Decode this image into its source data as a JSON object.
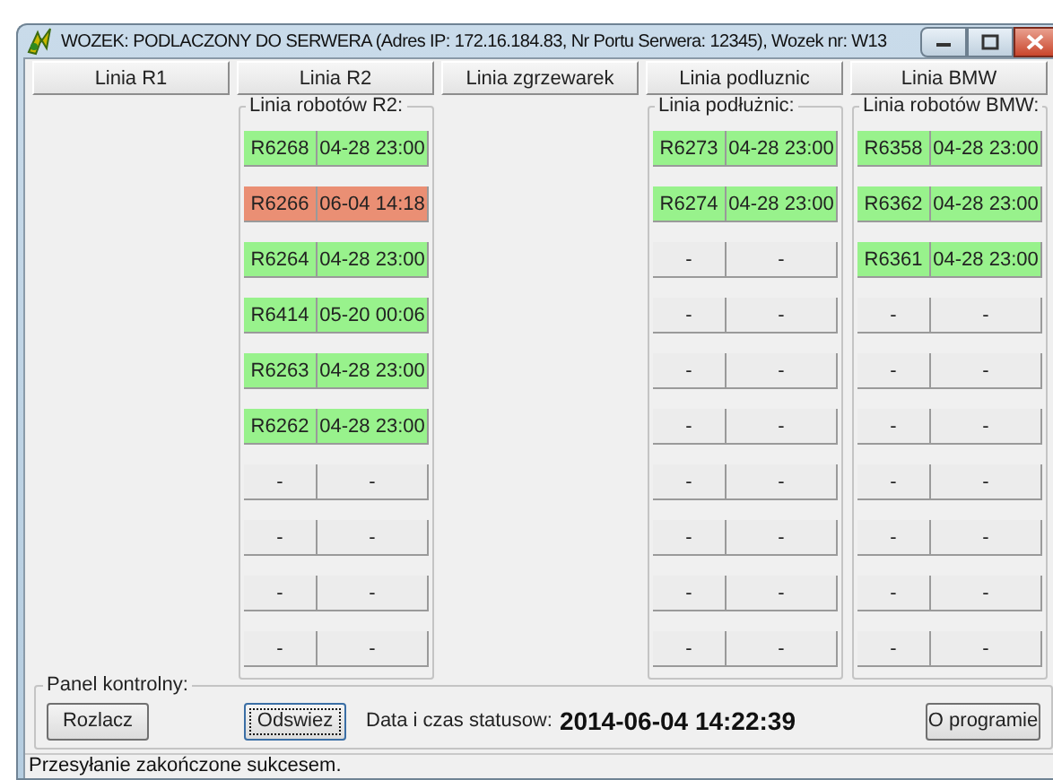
{
  "window": {
    "title": "WOZEK: PODLACZONY DO SERWERA (Adres IP: 172.16.184.83, Nr Portu Serwera: 12345), Wozek nr: W13"
  },
  "lines": [
    {
      "label": "Linia R1"
    },
    {
      "label": "Linia R2",
      "group": {
        "title": "Linia robotów R2:",
        "robots": [
          {
            "name": "R6268",
            "time": "04-28 23:00",
            "color": "#98f28c"
          },
          {
            "name": "R6266",
            "time": "06-04 14:18",
            "color": "#ea8f74"
          },
          {
            "name": "R6264",
            "time": "04-28 23:00",
            "color": "#98f28c"
          },
          {
            "name": "R6414",
            "time": "05-20 00:06",
            "color": "#98f28c"
          },
          {
            "name": "R6263",
            "time": "04-28 23:00",
            "color": "#98f28c"
          },
          {
            "name": "R6262",
            "time": "04-28 23:00",
            "color": "#98f28c"
          },
          {
            "name": "-",
            "time": "-",
            "color": "#ececec"
          },
          {
            "name": "-",
            "time": "-",
            "color": "#ececec"
          },
          {
            "name": "-",
            "time": "-",
            "color": "#ececec"
          },
          {
            "name": "-",
            "time": "-",
            "color": "#ececec"
          }
        ]
      }
    },
    {
      "label": "Linia zgrzewarek"
    },
    {
      "label": "Linia podluznic",
      "group": {
        "title": "Linia podłużnic:",
        "robots": [
          {
            "name": "R6273",
            "time": "04-28 23:00",
            "color": "#98f28c"
          },
          {
            "name": "R6274",
            "time": "04-28 23:00",
            "color": "#98f28c"
          },
          {
            "name": "-",
            "time": "-",
            "color": "#ececec"
          },
          {
            "name": "-",
            "time": "-",
            "color": "#ececec"
          },
          {
            "name": "-",
            "time": "-",
            "color": "#ececec"
          },
          {
            "name": "-",
            "time": "-",
            "color": "#ececec"
          },
          {
            "name": "-",
            "time": "-",
            "color": "#ececec"
          },
          {
            "name": "-",
            "time": "-",
            "color": "#ececec"
          },
          {
            "name": "-",
            "time": "-",
            "color": "#ececec"
          },
          {
            "name": "-",
            "time": "-",
            "color": "#ececec"
          }
        ]
      }
    },
    {
      "label": "Linia BMW",
      "group": {
        "title": "Linia robotów BMW:",
        "robots": [
          {
            "name": "R6358",
            "time": "04-28 23:00",
            "color": "#98f28c"
          },
          {
            "name": "R6362",
            "time": "04-28 23:00",
            "color": "#98f28c"
          },
          {
            "name": "R6361",
            "time": "04-28 23:00",
            "color": "#98f28c"
          },
          {
            "name": "-",
            "time": "-",
            "color": "#ececec"
          },
          {
            "name": "-",
            "time": "-",
            "color": "#ececec"
          },
          {
            "name": "-",
            "time": "-",
            "color": "#ececec"
          },
          {
            "name": "-",
            "time": "-",
            "color": "#ececec"
          },
          {
            "name": "-",
            "time": "-",
            "color": "#ececec"
          },
          {
            "name": "-",
            "time": "-",
            "color": "#ececec"
          },
          {
            "name": "-",
            "time": "-",
            "color": "#ececec"
          }
        ]
      }
    }
  ],
  "control_panel": {
    "title": "Panel kontrolny:",
    "disconnect_button": "Rozlacz",
    "refresh_button": "Odswiez",
    "status_label": "Data i czas statusow:",
    "status_time": "2014-06-04 14:22:39",
    "about_button": "O programie"
  },
  "status_bar": "Przesyłanie zakończone sukcesem."
}
